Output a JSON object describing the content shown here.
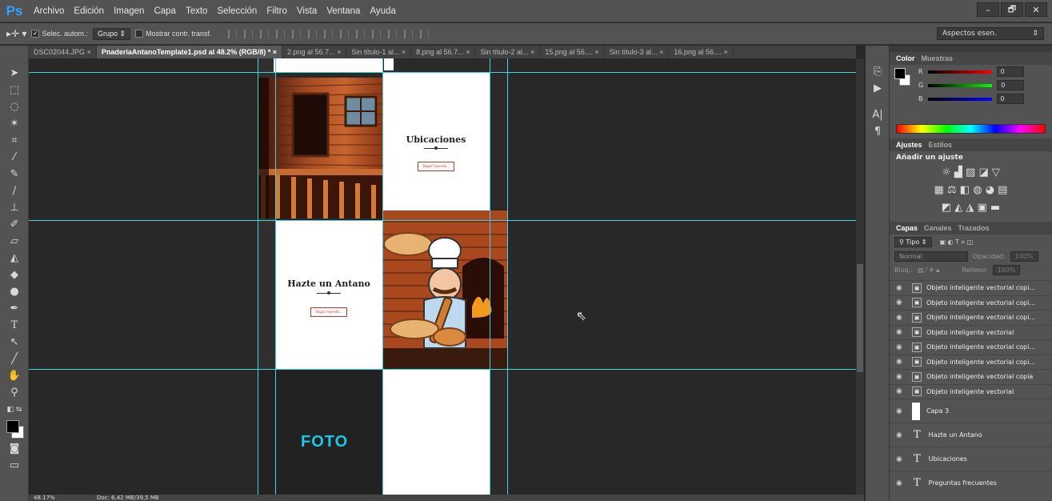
{
  "app": {
    "logo": "Ps"
  },
  "menu": [
    "Archivo",
    "Edición",
    "Imagen",
    "Capa",
    "Texto",
    "Selección",
    "Filtro",
    "Vista",
    "Ventana",
    "Ayuda"
  ],
  "window_controls": [
    "–",
    "🗗",
    "✕"
  ],
  "options": {
    "auto_select_label": "Selec. autom.:",
    "auto_select_value": "Grupo",
    "show_transform_label": "Mostrar contr. transf.",
    "workspace": "Aspectos esen."
  },
  "tabs": [
    {
      "label": "DSC02044.JPG",
      "active": false
    },
    {
      "label": "PnaderiaAntanoTemplate1.psd al 48.2% (RGB/8) *",
      "active": true
    },
    {
      "label": "2.png al 56.7...",
      "active": false
    },
    {
      "label": "Sin título-1 al...",
      "active": false
    },
    {
      "label": "8.png al 56.7...",
      "active": false
    },
    {
      "label": "Sin título-2 al...",
      "active": false
    },
    {
      "label": "15.png al 56....",
      "active": false
    },
    {
      "label": "Sin título-3 al...",
      "active": false
    },
    {
      "label": "16.png al 56....",
      "active": false
    }
  ],
  "tab_close": "×",
  "canvas": {
    "ubicaciones_title": "Ubicaciones",
    "ubicaciones_button": "Seguir leyendo...",
    "hazte_title": "Hazte un Antano",
    "hazte_button": "Seguir leyendo...",
    "foto_label": "FOTO"
  },
  "status": {
    "zoom": "48.17%",
    "doc": "Doc: 6,42 MB/39,5 MB"
  },
  "color_panel": {
    "tabs": [
      "Color",
      "Muestras"
    ],
    "channels": [
      {
        "label": "R",
        "value": "0"
      },
      {
        "label": "G",
        "value": "0"
      },
      {
        "label": "B",
        "value": "0"
      }
    ]
  },
  "adjust_panel": {
    "tabs": [
      "Ajustes",
      "Estilos"
    ],
    "heading": "Añadir un ajuste"
  },
  "layers_panel": {
    "tabs": [
      "Capas",
      "Canales",
      "Trazados"
    ],
    "filter": "Tipo",
    "blend": "Normal",
    "opacity_label": "Opacidad:",
    "opacity_value": "100%",
    "lock_label": "Bloq.:",
    "fill_label": "Relleno:",
    "fill_value": "100%",
    "layers": [
      {
        "name": "Objeto inteligente vectorial copi...",
        "kind": "smart"
      },
      {
        "name": "Objeto inteligente vectorial copi...",
        "kind": "smart"
      },
      {
        "name": "Objeto inteligente vectorial copi...",
        "kind": "smart"
      },
      {
        "name": "Objeto inteligente vectorial",
        "kind": "smart"
      },
      {
        "name": "Objeto inteligente vectorial copi...",
        "kind": "smart"
      },
      {
        "name": "Objeto inteligente vectorial copi...",
        "kind": "smart"
      },
      {
        "name": "Objeto inteligente vectorial copia",
        "kind": "smart"
      },
      {
        "name": "Objeto inteligente vectorial",
        "kind": "smart"
      },
      {
        "name": "Capa 3",
        "kind": "raster"
      },
      {
        "name": "Hazte un Antano",
        "kind": "text"
      },
      {
        "name": "Ubicaciones",
        "kind": "text"
      },
      {
        "name": "Preguntas frecuentes",
        "kind": "text"
      }
    ]
  },
  "colors": {
    "guide": "#3fd4e0",
    "foto": "#1ec8e6",
    "button_border": "#c0392b"
  }
}
